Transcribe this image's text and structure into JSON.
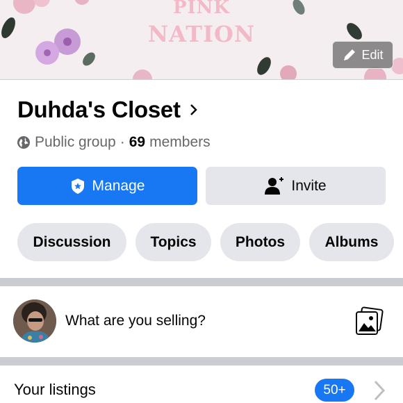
{
  "cover": {
    "line1": "PINK",
    "line2": "NATION",
    "edit_label": "Edit"
  },
  "group": {
    "name": "Duhda's Closet",
    "privacy": "Public group",
    "separator": "·",
    "member_count": "69",
    "members_label": "members"
  },
  "actions": {
    "manage_label": "Manage",
    "invite_label": "Invite"
  },
  "tabs": [
    {
      "label": "Discussion"
    },
    {
      "label": "Topics"
    },
    {
      "label": "Photos"
    },
    {
      "label": "Albums"
    }
  ],
  "composer": {
    "prompt": "What are you selling?"
  },
  "listings": {
    "label": "Your listings",
    "badge": "50+"
  },
  "colors": {
    "accent": "#1877f2",
    "chip_bg": "#e4e6eb",
    "separator": "#c9ccd1"
  }
}
